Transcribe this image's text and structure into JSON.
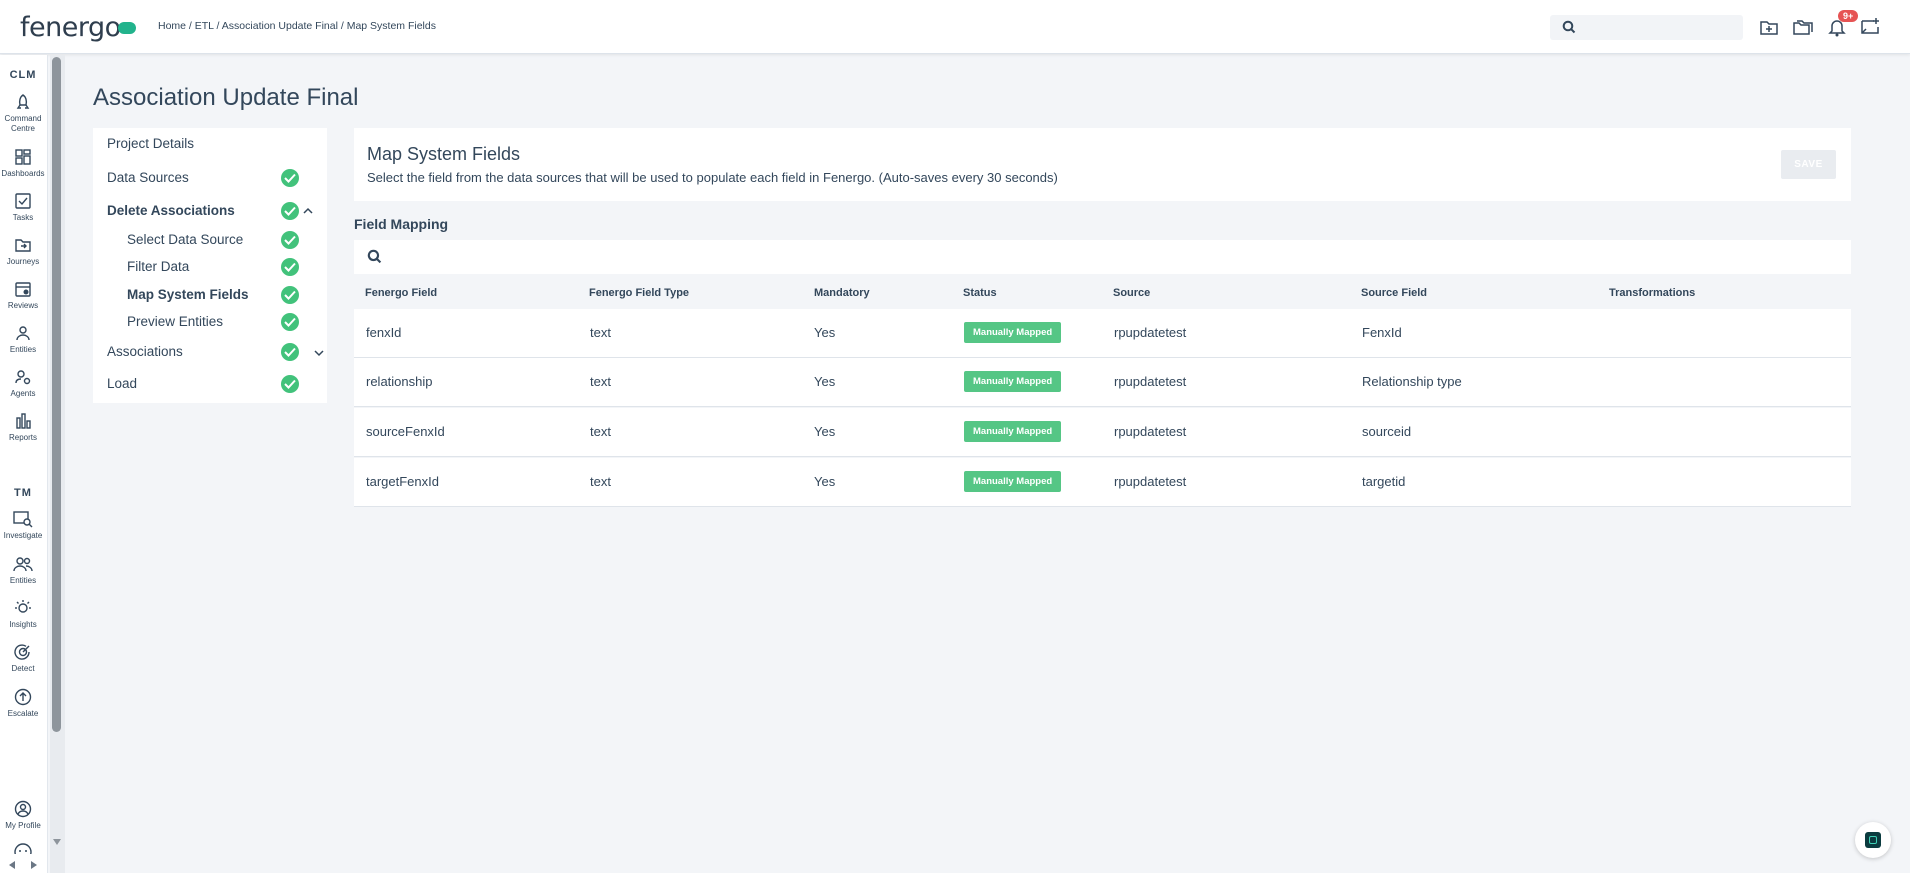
{
  "header": {
    "logo": "fenergo",
    "breadcrumb": "Home / ETL / Association Update Final / Map System Fields",
    "notification_badge": "9+"
  },
  "rail": {
    "sections": [
      "CLM",
      "TM"
    ],
    "clm_items": [
      {
        "label": "Command Centre",
        "icon": "rocket-icon"
      },
      {
        "label": "Dashboards",
        "icon": "dashboard-icon"
      },
      {
        "label": "Tasks",
        "icon": "tasks-icon"
      },
      {
        "label": "Journeys",
        "icon": "journeys-icon"
      },
      {
        "label": "Reviews",
        "icon": "reviews-icon"
      },
      {
        "label": "Entities",
        "icon": "entities-icon"
      },
      {
        "label": "Agents",
        "icon": "agents-icon"
      },
      {
        "label": "Reports",
        "icon": "reports-icon"
      }
    ],
    "tm_items": [
      {
        "label": "Investigate",
        "icon": "investigate-icon"
      },
      {
        "label": "Entities",
        "icon": "tm-entities-icon"
      },
      {
        "label": "Insights",
        "icon": "insights-icon"
      },
      {
        "label": "Detect",
        "icon": "detect-icon"
      },
      {
        "label": "Escalate",
        "icon": "escalate-icon"
      }
    ],
    "profile": "My Profile"
  },
  "page": {
    "title": "Association Update Final"
  },
  "steps": [
    {
      "label": "Project Details"
    },
    {
      "label": "Data Sources"
    },
    {
      "label": "Delete Associations"
    },
    {
      "label": "Select Data Source"
    },
    {
      "label": "Filter Data"
    },
    {
      "label": "Map System Fields"
    },
    {
      "label": "Preview Entities"
    },
    {
      "label": "Associations"
    },
    {
      "label": "Load"
    }
  ],
  "card": {
    "title": "Map System Fields",
    "description": "Select the field from the data sources that will be used to populate each field in Fenergo. (Auto-saves every 30 seconds)",
    "save_label": "SAVE"
  },
  "field_mapping": {
    "title": "Field Mapping",
    "columns": [
      "Fenergo Field",
      "Fenergo Field Type",
      "Mandatory",
      "Status",
      "Source",
      "Source Field",
      "Transformations"
    ],
    "rows": [
      {
        "field": "fenxId",
        "type": "text",
        "mandatory": "Yes",
        "status": "Manually Mapped",
        "source": "rpupdatetest",
        "source_field": "FenxId",
        "transformations": ""
      },
      {
        "field": "relationship",
        "type": "text",
        "mandatory": "Yes",
        "status": "Manually Mapped",
        "source": "rpupdatetest",
        "source_field": "Relationship type",
        "transformations": ""
      },
      {
        "field": "sourceFenxId",
        "type": "text",
        "mandatory": "Yes",
        "status": "Manually Mapped",
        "source": "rpupdatetest",
        "source_field": "sourceid",
        "transformations": ""
      },
      {
        "field": "targetFenxId",
        "type": "text",
        "mandatory": "Yes",
        "status": "Manually Mapped",
        "source": "rpupdatetest",
        "source_field": "targetid",
        "transformations": ""
      }
    ]
  },
  "colors": {
    "accent_green": "#42c27b",
    "status_green": "#55c685",
    "text": "#33475b",
    "background": "#f3f5f8"
  }
}
